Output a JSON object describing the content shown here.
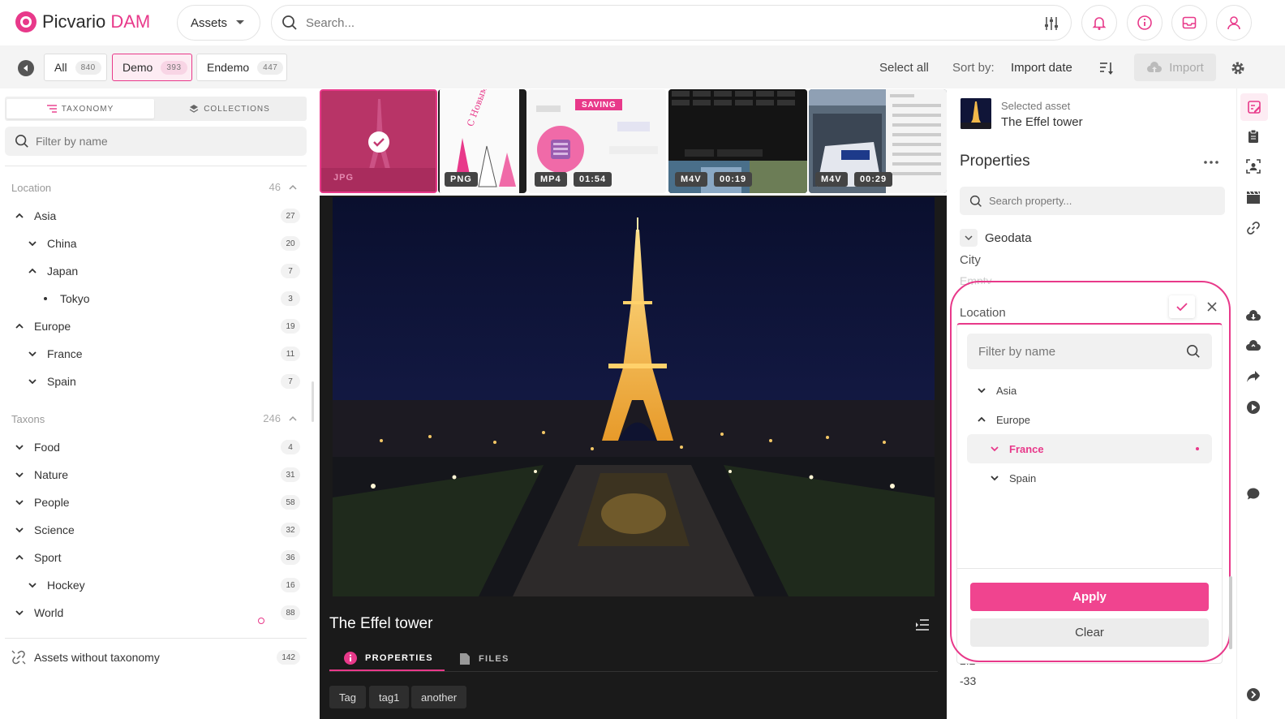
{
  "header": {
    "logo_name": "Picvario",
    "logo_accent": "DAM",
    "assets_dropdown": "Assets",
    "search_placeholder": "Search..."
  },
  "toolbar": {
    "chips": [
      {
        "label": "All",
        "count": "840"
      },
      {
        "label": "Demo",
        "count": "393"
      },
      {
        "label": "Endemo",
        "count": "447"
      }
    ],
    "select_all": "Select all",
    "sort_by_label": "Sort by:",
    "sort_value": "Import date",
    "import_label": "Import"
  },
  "sidebar": {
    "tab_taxonomy": "TAXONOMY",
    "tab_collections": "COLLECTIONS",
    "filter_placeholder": "Filter by name",
    "location_title": "Location",
    "location_count": "46",
    "location_items": [
      {
        "label": "Asia",
        "count": "27",
        "level": 0,
        "state": "expanded"
      },
      {
        "label": "China",
        "count": "20",
        "level": 1,
        "state": "collapsed"
      },
      {
        "label": "Japan",
        "count": "7",
        "level": 1,
        "state": "expanded"
      },
      {
        "label": "Tokyo",
        "count": "3",
        "level": 2,
        "state": "leaf"
      },
      {
        "label": "Europe",
        "count": "19",
        "level": 0,
        "state": "expanded"
      },
      {
        "label": "France",
        "count": "11",
        "level": 1,
        "state": "collapsed"
      },
      {
        "label": "Spain",
        "count": "7",
        "level": 1,
        "state": "collapsed"
      }
    ],
    "taxons_title": "Taxons",
    "taxons_count": "246",
    "taxon_items": [
      {
        "label": "Food",
        "count": "4",
        "level": 0,
        "state": "collapsed"
      },
      {
        "label": "Nature",
        "count": "31",
        "level": 0,
        "state": "collapsed"
      },
      {
        "label": "People",
        "count": "58",
        "level": 0,
        "state": "collapsed"
      },
      {
        "label": "Science",
        "count": "32",
        "level": 0,
        "state": "collapsed"
      },
      {
        "label": "Sport",
        "count": "36",
        "level": 0,
        "state": "expanded"
      },
      {
        "label": "Hockey",
        "count": "16",
        "level": 1,
        "state": "collapsed"
      },
      {
        "label": "World",
        "count": "88",
        "level": 0,
        "state": "collapsed"
      }
    ],
    "without_taxonomy": "Assets without taxonomy",
    "without_taxonomy_count": "142"
  },
  "thumbs": [
    {
      "format": "JPG"
    },
    {
      "format": "PNG"
    },
    {
      "format": "MP4",
      "duration": "01:54",
      "status": "SAVING"
    },
    {
      "format": "M4V",
      "duration": "00:19"
    },
    {
      "format": "M4V",
      "duration": "00:29"
    }
  ],
  "viewer": {
    "title": "The Effel tower",
    "tab_properties": "PROPERTIES",
    "tab_files": "FILES",
    "tags": [
      "Tag",
      "tag1",
      "another"
    ]
  },
  "right_panel": {
    "selected_label": "Selected asset",
    "selected_name": "The Effel tower",
    "properties_title": "Properties",
    "search_placeholder": "Search property...",
    "group": "Geodata",
    "city_label": "City",
    "city_value": "Empty",
    "location_label": "Location",
    "partial_value_1": "2.2",
    "partial_value_2": "-33"
  },
  "popup": {
    "filter_placeholder": "Filter by name",
    "items": [
      {
        "label": "Asia",
        "level": 0,
        "state": "collapsed"
      },
      {
        "label": "Europe",
        "level": 0,
        "state": "expanded"
      },
      {
        "label": "France",
        "level": 1,
        "state": "collapsed",
        "selected": true
      },
      {
        "label": "Spain",
        "level": 1,
        "state": "collapsed"
      }
    ],
    "apply_label": "Apply",
    "clear_label": "Clear"
  },
  "colors": {
    "accent": "#e8398a",
    "viewer_bg": "#1a1a1a"
  }
}
